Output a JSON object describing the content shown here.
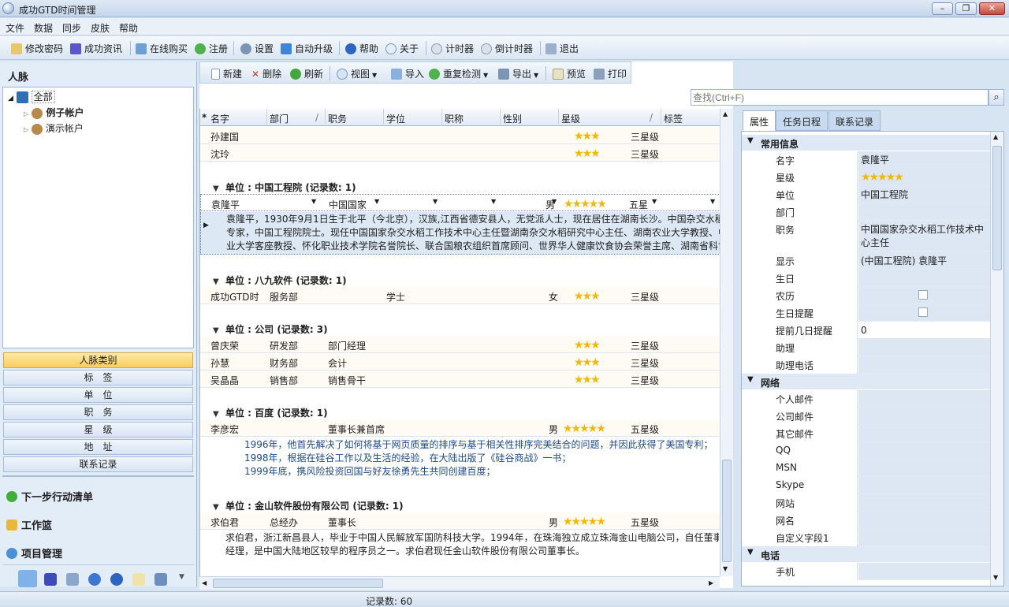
{
  "window": {
    "title": "成功GTD时间管理"
  },
  "menu": [
    "文件",
    "数据",
    "同步",
    "皮肤",
    "帮助"
  ],
  "toolbar1": {
    "change_password": "修改密码",
    "news": "成功资讯",
    "buy_online": "在线购买",
    "register": "注册",
    "settings": "设置",
    "auto_upgrade": "自动升级",
    "help": "帮助",
    "about": "关于",
    "timer": "计时器",
    "countdown": "倒计时器",
    "exit": "退出"
  },
  "left": {
    "title": "人脉",
    "tree": {
      "root": "全部",
      "child1": "例子帐户",
      "child2": "演示帐户"
    },
    "nav": [
      "人脉类别",
      "标　签",
      "单　位",
      "职　务",
      "星　级",
      "地　址",
      "联系记录"
    ],
    "sections": [
      "下一步行动清单",
      "工作篮",
      "项目管理"
    ]
  },
  "toolbar2": {
    "new": "新建",
    "delete": "删除",
    "refresh": "刷新",
    "view": "视图",
    "import": "导入",
    "dup_check": "重复检测",
    "export": "导出",
    "preview": "预览",
    "print": "打印"
  },
  "search": {
    "placeholder": "查找(Ctrl+F)"
  },
  "grid": {
    "headers": [
      "名字",
      "部门",
      "职务",
      "学位",
      "职称",
      "性别",
      "星级",
      "标签"
    ],
    "r1": {
      "name": "孙建国",
      "level": "三星级"
    },
    "r2": {
      "name": "沈玲",
      "level": "三星级"
    },
    "g1": "单位 : 中国工程院 (记录数: 1)",
    "r3": {
      "name": "袁隆平",
      "title": "中国国家",
      "sex": "男",
      "level": "五星"
    },
    "note1": [
      "袁隆平，1930年9月1日生于北平（今北京），汉族,江西省德安县人，无党派人士，现在居住在湖南长沙。中国杂交水稻",
      "专家，中国工程院院士。现任中国国家杂交水稻工作技术中心主任暨湖南杂交水稻研究中心主任、湖南农业大学教授、中",
      "业大学客座教授、怀化职业技术学院名誉院长、联合国粮农组织首席顾问、世界华人健康饮食协会荣誉主席、湖南省科协"
    ],
    "g2": "单位 : 八九软件 (记录数: 1)",
    "r4": {
      "name": "成功GTD时",
      "dept": "服务部",
      "degree": "学士",
      "sex": "女",
      "level": "三星级"
    },
    "g3": "单位 : 公司 (记录数: 3)",
    "r5": {
      "name": "曾庆荣",
      "dept": "研发部",
      "title": "部门经理",
      "level": "三星级"
    },
    "r6": {
      "name": "孙慧",
      "dept": "财务部",
      "title": "会计",
      "level": "三星级"
    },
    "r7": {
      "name": "吴晶晶",
      "dept": "销售部",
      "title": "销售骨干",
      "level": "三星级"
    },
    "g4": "单位 : 百度 (记录数: 1)",
    "r8": {
      "name": "李彦宏",
      "title": "董事长兼首席",
      "sex": "男",
      "level": "五星级"
    },
    "note2": [
      "1996年，他首先解决了如何将基于网页质量的排序与基于相关性排序完美结合的问题，并因此获得了美国专利；",
      "1998年，根据在硅谷工作以及生活的经验，在大陆出版了《硅谷商战》一书；",
      "1999年底，携风险投资回国与好友徐勇先生共同创建百度；"
    ],
    "g5": "单位 : 金山软件股份有限公司 (记录数: 1)",
    "r9": {
      "name": "求伯君",
      "dept": "总经办",
      "title": "董事长",
      "sex": "男",
      "level": "五星级"
    },
    "note3": [
      "求伯君，浙江新昌县人，毕业于中国人民解放军国防科技大学。1994年，在珠海独立成立珠海金山电脑公司，自任董事",
      "经理，是中国大陆地区较早的程序员之一。求伯君现任金山软件股份有限公司董事长。"
    ]
  },
  "right": {
    "tabs": [
      "属性",
      "任务日程",
      "联系记录"
    ],
    "cat1": "常用信息",
    "p": {
      "name": "名字",
      "name_v": "袁隆平",
      "star": "星级",
      "unit": "单位",
      "unit_v": "中国工程院",
      "dept": "部门",
      "title": "职务",
      "title_v": "中国国家杂交水稻工作技术中心主任",
      "display": "显示",
      "display_v": "(中国工程院) 袁隆平",
      "birthday": "生日",
      "lunar": "农历",
      "bday_remind": "生日提醒",
      "remind_days": "提前几日提醒",
      "remind_days_v": "0",
      "assistant": "助理",
      "assistant_phone": "助理电话"
    },
    "cat2": "网络",
    "net": [
      "个人邮件",
      "公司邮件",
      "其它邮件",
      "QQ",
      "MSN",
      "Skype",
      "网站",
      "网名",
      "自定义字段1"
    ],
    "cat3": "电话",
    "phone": [
      "手机"
    ]
  },
  "status": {
    "records": "记录数: 60"
  },
  "colors": {
    "accent": "#f8cd5d",
    "star": "#f2b900",
    "note_text": "#1d4a8a"
  }
}
